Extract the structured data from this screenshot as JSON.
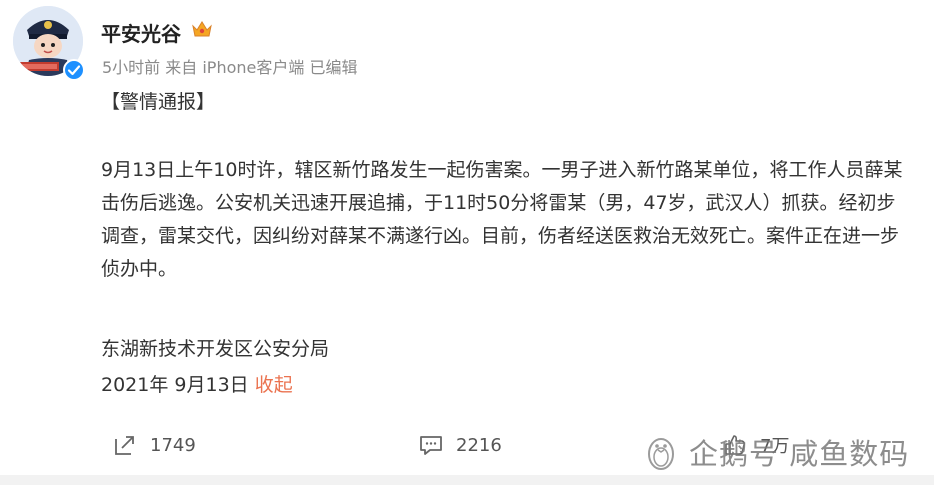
{
  "post": {
    "username": "平安光谷",
    "meta": "5小时前  来自 iPhone客户端 已编辑",
    "heading": "【警情通报】",
    "body": "9月13日上午10时许，辖区新竹路发生一起伤害案。一男子进入新竹路某单位，将工作人员薛某击伤后逃逸。公安机关迅速开展追捕，于11时50分将雷某（男，47岁，武汉人）抓获。经初步调查，雷某交代，因纠纷对薛某不满遂行凶。目前，伤者经送医救治无效死亡。案件正在进一步侦办中。",
    "signature": "东湖新技术开发区公安分局",
    "date": "2021年 9月13日",
    "collapse_label": "收起"
  },
  "actions": {
    "repost_count": "1749",
    "comment_count": "2216",
    "like_count": "7万"
  },
  "watermark": {
    "text": "企鹅号 咸鱼数码"
  },
  "colors": {
    "accent": "#eb7350",
    "verified": "#1e90ff",
    "crown": "#f5a623"
  },
  "icons": [
    "avatar-police-cartoon",
    "verified-badge-icon",
    "crown-icon",
    "repost-icon",
    "comment-icon",
    "like-icon",
    "penguin-icon"
  ]
}
